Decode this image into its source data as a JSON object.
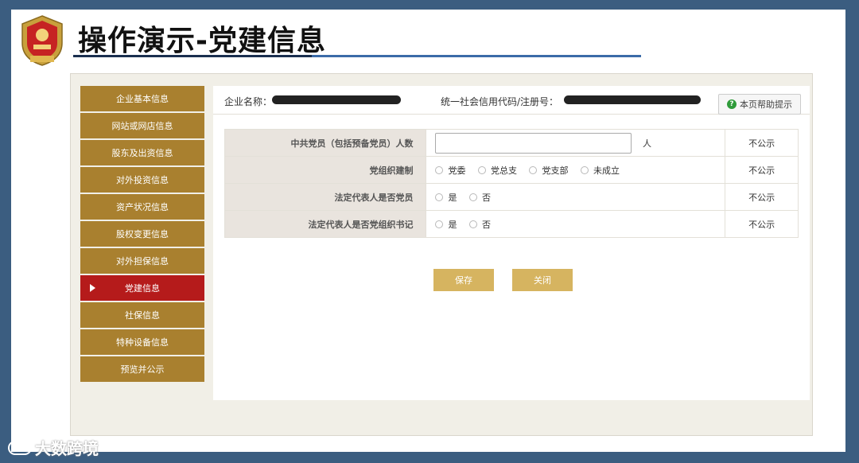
{
  "slide": {
    "title": "操作演示-党建信息"
  },
  "sidebar": {
    "items": [
      {
        "label": "企业基本信息"
      },
      {
        "label": "网站或网店信息"
      },
      {
        "label": "股东及出资信息"
      },
      {
        "label": "对外投资信息"
      },
      {
        "label": "资产状况信息"
      },
      {
        "label": "股权变更信息"
      },
      {
        "label": "对外担保信息"
      },
      {
        "label": "党建信息",
        "active": true
      },
      {
        "label": "社保信息"
      },
      {
        "label": "特种设备信息"
      },
      {
        "label": "预览并公示"
      }
    ]
  },
  "info": {
    "company_name_label": "企业名称：",
    "credit_code_label": "统一社会信用代码/注册号：",
    "help_label": "本页帮助提示"
  },
  "form": {
    "rows": [
      {
        "label": "中共党员（包括预备党员）人数",
        "unit": "人",
        "public": "不公示"
      },
      {
        "label": "党组织建制",
        "options": [
          "党委",
          "党总支",
          "党支部",
          "未成立"
        ],
        "public": "不公示"
      },
      {
        "label": "法定代表人是否党员",
        "options": [
          "是",
          "否"
        ],
        "public": "不公示"
      },
      {
        "label": "法定代表人是否党组织书记",
        "options": [
          "是",
          "否"
        ],
        "public": "不公示"
      }
    ]
  },
  "buttons": {
    "save": "保存",
    "close": "关闭"
  },
  "watermark": {
    "text": "大数跨境"
  },
  "colors": {
    "sidebar": "#a9802f",
    "sidebar_active": "#b51b1b",
    "button": "#d6b460",
    "frame_bg": "#f1efe7",
    "slide_border": "#3b5d80"
  }
}
